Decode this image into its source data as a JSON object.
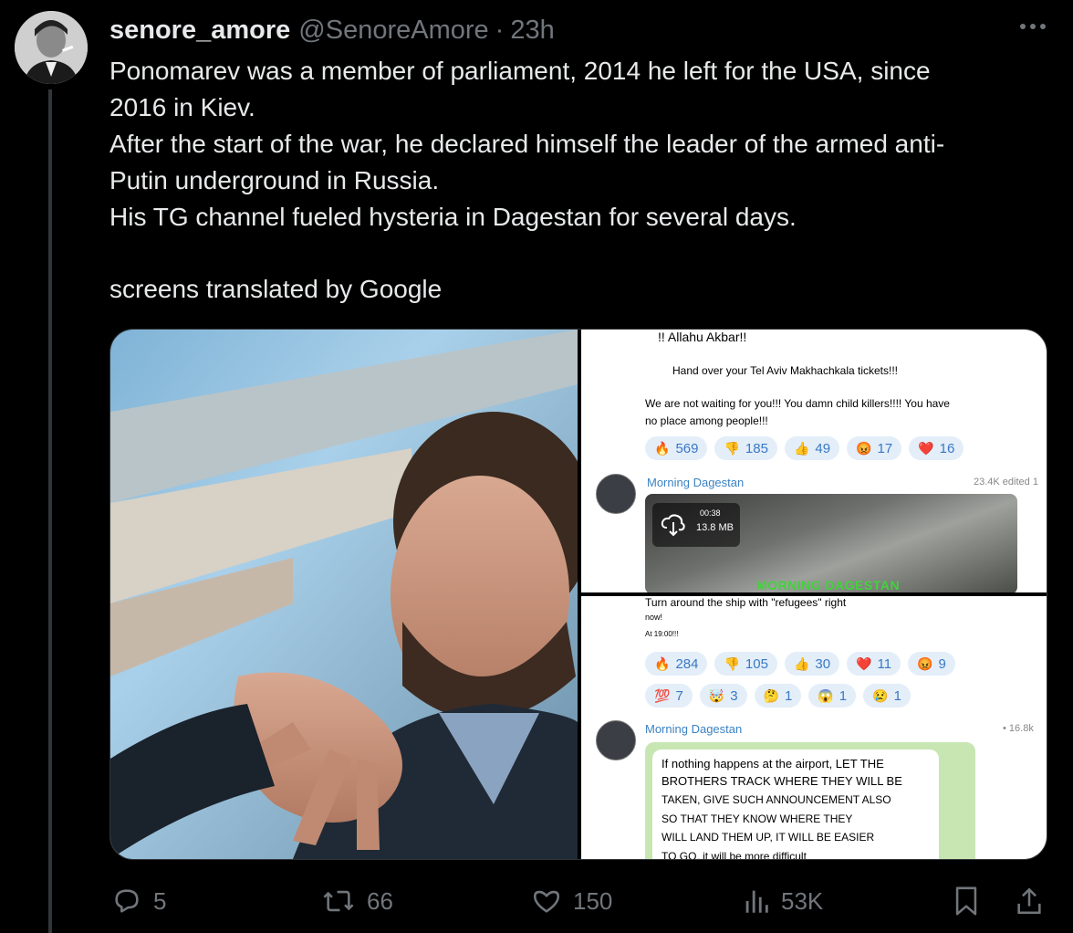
{
  "tweet": {
    "display_name": "senore_amore",
    "handle": "@SenoreAmore",
    "separator": "·",
    "time": "23h",
    "lines": [
      "Ponomarev was a member of parliament, 2014 he left for the USA, since",
      "2016 in Kiev.",
      "After the start of the war, he declared himself the leader of the armed anti-",
      "Putin underground in Russia.",
      "His TG channel fueled hysteria in Dagestan for several days.",
      "screens translated by Google"
    ]
  },
  "screenshot1": {
    "header": "!! Allahu Akbar!!",
    "line1": "Hand over your Tel Aviv Makhachkala tickets!!!",
    "line2": "We are not waiting for you!!! You damn child killers!!!! You have",
    "line3": "no place among people!!!",
    "reactions": [
      {
        "emoji": "🔥",
        "count": "569"
      },
      {
        "emoji": "👎",
        "count": "185"
      },
      {
        "emoji": "👍",
        "count": "49"
      },
      {
        "emoji": "😡",
        "count": "17"
      },
      {
        "emoji": "❤️",
        "count": "16"
      }
    ],
    "channel": "Morning Dagestan",
    "views": "23.4K edited 1",
    "video_duration": "00:38",
    "video_size": "13.8 MB",
    "video_caption": "MORNING DAGESTAN"
  },
  "screenshot2": {
    "line1": "Turn around the ship with \"refugees\" right",
    "line2": "now!",
    "line3": "At 19:00!!!",
    "reactions_row1": [
      {
        "emoji": "🔥",
        "count": "284"
      },
      {
        "emoji": "👎",
        "count": "105"
      },
      {
        "emoji": "👍",
        "count": "30"
      },
      {
        "emoji": "❤️",
        "count": "11"
      },
      {
        "emoji": "😡",
        "count": "9"
      }
    ],
    "reactions_row2": [
      {
        "emoji": "💯",
        "count": "7"
      },
      {
        "emoji": "🤯",
        "count": "3"
      },
      {
        "emoji": "🤔",
        "count": "1"
      },
      {
        "emoji": "😱",
        "count": "1"
      },
      {
        "emoji": "😢",
        "count": "1"
      }
    ],
    "channel": "Morning Dagestan",
    "views": "• 16.8k",
    "post_lines": [
      "If nothing happens at the airport, LET THE",
      "BROTHERS TRACK WHERE THEY WILL BE",
      "TAKEN, GIVE SUCH ANNOUNCEMENT ALSO",
      "SO THAT THEY KNOW WHERE THEY",
      "WILL LAND THEM UP, IT WILL BE EASIER",
      "TO GO, it will be more difficult"
    ]
  },
  "actions": {
    "replies": "5",
    "reposts": "66",
    "likes": "150",
    "views": "53K"
  },
  "icons": {
    "more": "more-icon",
    "reply": "reply-icon",
    "repost": "repost-icon",
    "like": "like-icon",
    "views": "views-icon",
    "bookmark": "bookmark-icon",
    "share": "share-icon"
  }
}
